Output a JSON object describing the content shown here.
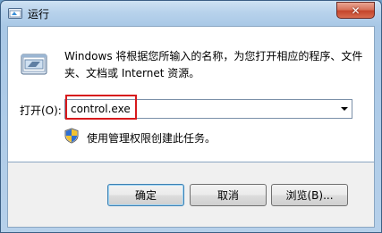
{
  "window": {
    "title": "运行",
    "close_symbol": "✕"
  },
  "dialog": {
    "description": "Windows 将根据您所输入的名称，为您打开相应的程序、文件夹、文档或 Internet 资源。",
    "open_label": "打开(O):",
    "input_value": "control.exe",
    "admin_note": "使用管理权限创建此任务。"
  },
  "buttons": {
    "ok": "确定",
    "cancel": "取消",
    "browse": "浏览(B)..."
  },
  "icons": {
    "title": "run-app-icon",
    "dialog": "run-icon",
    "admin": "shield-icon",
    "dropdown": "chevron-down-icon"
  },
  "colors": {
    "highlight": "#d7191c",
    "close_button": "#c4452c"
  }
}
